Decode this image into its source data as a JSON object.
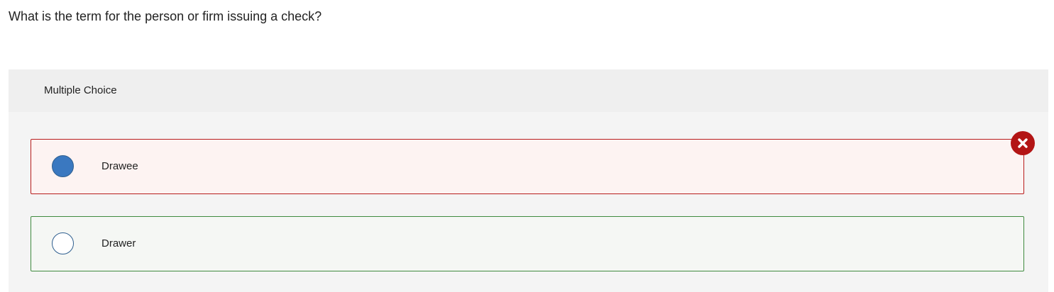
{
  "question": {
    "text": "What is the term for the person or firm issuing a check?"
  },
  "panel": {
    "header_label": "Multiple Choice",
    "options": [
      {
        "label": "Drawee",
        "selected": true,
        "status": "incorrect"
      },
      {
        "label": "Drawer",
        "selected": false,
        "status": "correct"
      }
    ]
  },
  "feedback": {
    "icon": "close-icon"
  },
  "colors": {
    "incorrect_border": "#b71c1c",
    "incorrect_background": "#fdf3f2",
    "correct_border": "#3f8a3f",
    "correct_background": "#f5f7f4",
    "selected_radio": "#3a78c0",
    "wrong_badge": "#b31515"
  }
}
